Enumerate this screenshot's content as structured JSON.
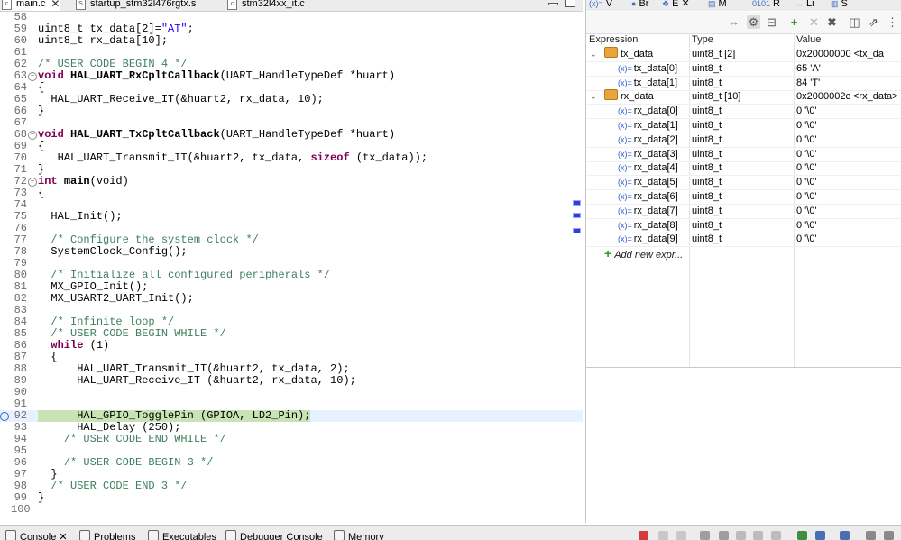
{
  "editor_tabs": [
    {
      "label": "main.c",
      "active": true,
      "closable": true
    },
    {
      "label": "startup_stm32l476rgtx.s",
      "active": false,
      "closable": false
    },
    {
      "label": "stm32l4xx_it.c",
      "active": false,
      "closable": false
    }
  ],
  "code_lines": [
    {
      "n": "58",
      "tokens": []
    },
    {
      "n": "59",
      "tokens": [
        {
          "t": "uint8_t tx_data[2]="
        },
        {
          "t": "\"AT\"",
          "c": "str"
        },
        {
          "t": ";"
        }
      ]
    },
    {
      "n": "60",
      "tokens": [
        {
          "t": "uint8_t rx_data[10];"
        }
      ]
    },
    {
      "n": "61",
      "tokens": []
    },
    {
      "n": "62",
      "tokens": [
        {
          "t": "/* USER CODE BEGIN 4 */",
          "c": "cm"
        }
      ]
    },
    {
      "n": "63",
      "fold": true,
      "tokens": [
        {
          "t": "void",
          "c": "kw"
        },
        {
          "t": " "
        },
        {
          "t": "HAL_UART_RxCpltCallback",
          "c": "fn"
        },
        {
          "t": "(UART_HandleTypeDef *huart)"
        }
      ]
    },
    {
      "n": "64",
      "tokens": [
        {
          "t": "{"
        }
      ]
    },
    {
      "n": "65",
      "tokens": [
        {
          "t": "  HAL_UART_Receive_IT(&huart2, rx_data, 10);"
        }
      ]
    },
    {
      "n": "66",
      "tokens": [
        {
          "t": "}"
        }
      ]
    },
    {
      "n": "67",
      "tokens": []
    },
    {
      "n": "68",
      "fold": true,
      "tokens": [
        {
          "t": "void",
          "c": "kw"
        },
        {
          "t": " "
        },
        {
          "t": "HAL_UART_TxCpltCallback",
          "c": "fn"
        },
        {
          "t": "(UART_HandleTypeDef *huart)"
        }
      ]
    },
    {
      "n": "69",
      "tokens": [
        {
          "t": "{"
        }
      ]
    },
    {
      "n": "70",
      "tokens": [
        {
          "t": "   HAL_UART_Transmit_IT(&huart2, tx_data, "
        },
        {
          "t": "sizeof",
          "c": "kw"
        },
        {
          "t": " (tx_data));"
        }
      ]
    },
    {
      "n": "71",
      "tokens": [
        {
          "t": "}"
        }
      ]
    },
    {
      "n": "72",
      "fold": true,
      "tokens": [
        {
          "t": "int",
          "c": "kw"
        },
        {
          "t": " "
        },
        {
          "t": "main",
          "c": "fn"
        },
        {
          "t": "(void)"
        }
      ]
    },
    {
      "n": "73",
      "tokens": [
        {
          "t": "{"
        }
      ]
    },
    {
      "n": "74",
      "tokens": []
    },
    {
      "n": "75",
      "tokens": [
        {
          "t": "  HAL_Init();"
        }
      ]
    },
    {
      "n": "76",
      "tokens": []
    },
    {
      "n": "77",
      "tokens": [
        {
          "t": "  "
        },
        {
          "t": "/* Configure the system clock */",
          "c": "cm"
        }
      ]
    },
    {
      "n": "78",
      "tokens": [
        {
          "t": "  SystemClock_Config();"
        }
      ]
    },
    {
      "n": "79",
      "tokens": []
    },
    {
      "n": "80",
      "tokens": [
        {
          "t": "  "
        },
        {
          "t": "/* Initialize all configured peripherals */",
          "c": "cm"
        }
      ]
    },
    {
      "n": "81",
      "tokens": [
        {
          "t": "  MX_GPIO_Init();"
        }
      ]
    },
    {
      "n": "82",
      "tokens": [
        {
          "t": "  MX_USART2_UART_Init();"
        }
      ]
    },
    {
      "n": "83",
      "tokens": []
    },
    {
      "n": "84",
      "tokens": [
        {
          "t": "  "
        },
        {
          "t": "/* Infinite loop */",
          "c": "cm"
        }
      ]
    },
    {
      "n": "85",
      "tokens": [
        {
          "t": "  "
        },
        {
          "t": "/* USER CODE BEGIN WHILE */",
          "c": "cm"
        }
      ]
    },
    {
      "n": "86",
      "tokens": [
        {
          "t": "  "
        },
        {
          "t": "while",
          "c": "kw"
        },
        {
          "t": " (1)"
        }
      ]
    },
    {
      "n": "87",
      "tokens": [
        {
          "t": "  {"
        }
      ]
    },
    {
      "n": "88",
      "tokens": [
        {
          "t": "      HAL_UART_Transmit_IT(&huart2, tx_data, 2);"
        }
      ]
    },
    {
      "n": "89",
      "tokens": [
        {
          "t": "      HAL_UART_Receive_IT (&huart2, rx_data, 10);"
        }
      ]
    },
    {
      "n": "90",
      "tokens": []
    },
    {
      "n": "91",
      "tokens": []
    },
    {
      "n": "92",
      "current": true,
      "tokens": [
        {
          "t": "      HAL_GPIO_TogglePin (GPIOA, LD2_Pin);"
        }
      ]
    },
    {
      "n": "93",
      "tokens": [
        {
          "t": "      HAL_Delay (250);"
        }
      ]
    },
    {
      "n": "94",
      "tokens": [
        {
          "t": "    "
        },
        {
          "t": "/* USER CODE END WHILE */",
          "c": "cm"
        }
      ]
    },
    {
      "n": "95",
      "tokens": []
    },
    {
      "n": "96",
      "tokens": [
        {
          "t": "    "
        },
        {
          "t": "/* USER CODE BEGIN 3 */",
          "c": "cm"
        }
      ]
    },
    {
      "n": "97",
      "tokens": [
        {
          "t": "  }"
        }
      ]
    },
    {
      "n": "98",
      "tokens": [
        {
          "t": "  "
        },
        {
          "t": "/* USER CODE END 3 */",
          "c": "cm"
        }
      ]
    },
    {
      "n": "99",
      "tokens": [
        {
          "t": "}"
        }
      ]
    },
    {
      "n": "100",
      "tokens": []
    }
  ],
  "expr_tabs": [
    {
      "icon": "(x)=",
      "label": "V"
    },
    {
      "icon": "●",
      "label": "Br"
    },
    {
      "icon": "❖",
      "label": "E"
    },
    {
      "icon": "▤",
      "label": "M"
    },
    {
      "icon": "0101",
      "label": "R"
    },
    {
      "icon": "↔",
      "label": "Li"
    },
    {
      "icon": "▥",
      "label": "S"
    }
  ],
  "expr_headers": {
    "expression": "Expression",
    "type": "Type",
    "value": "Value"
  },
  "expr_rows": [
    {
      "expr": "tx_data",
      "type": "uint8_t [2]",
      "value": "0x20000000 <tx_da",
      "level": 0,
      "array": true,
      "expanded": true
    },
    {
      "expr": "tx_data[0]",
      "type": "uint8_t",
      "value": "65 'A'",
      "level": 1
    },
    {
      "expr": "tx_data[1]",
      "type": "uint8_t",
      "value": "84 'T'",
      "level": 1
    },
    {
      "expr": "rx_data",
      "type": "uint8_t [10]",
      "value": "0x2000002c <rx_data>",
      "level": 0,
      "array": true,
      "expanded": true
    },
    {
      "expr": "rx_data[0]",
      "type": "uint8_t",
      "value": "0 '\\0'",
      "level": 1
    },
    {
      "expr": "rx_data[1]",
      "type": "uint8_t",
      "value": "0 '\\0'",
      "level": 1
    },
    {
      "expr": "rx_data[2]",
      "type": "uint8_t",
      "value": "0 '\\0'",
      "level": 1
    },
    {
      "expr": "rx_data[3]",
      "type": "uint8_t",
      "value": "0 '\\0'",
      "level": 1
    },
    {
      "expr": "rx_data[4]",
      "type": "uint8_t",
      "value": "0 '\\0'",
      "level": 1
    },
    {
      "expr": "rx_data[5]",
      "type": "uint8_t",
      "value": "0 '\\0'",
      "level": 1
    },
    {
      "expr": "rx_data[6]",
      "type": "uint8_t",
      "value": "0 '\\0'",
      "level": 1
    },
    {
      "expr": "rx_data[7]",
      "type": "uint8_t",
      "value": "0 '\\0'",
      "level": 1
    },
    {
      "expr": "rx_data[8]",
      "type": "uint8_t",
      "value": "0 '\\0'",
      "level": 1
    },
    {
      "expr": "rx_data[9]",
      "type": "uint8_t",
      "value": "0 '\\0'",
      "level": 1
    },
    {
      "expr": "Add new expr...",
      "type": "",
      "value": "",
      "level": 0,
      "add": true
    }
  ],
  "bottom_tabs": [
    {
      "label": "Console",
      "closable": true
    },
    {
      "label": "Problems"
    },
    {
      "label": "Executables"
    },
    {
      "label": "Debugger Console"
    },
    {
      "label": "Memory"
    }
  ],
  "colors": {
    "keyword": "#7f0055",
    "string": "#2a00ff",
    "comment": "#3f7f5f",
    "current_line": "#c9e3b5",
    "array_icon": "#e9a43b"
  }
}
